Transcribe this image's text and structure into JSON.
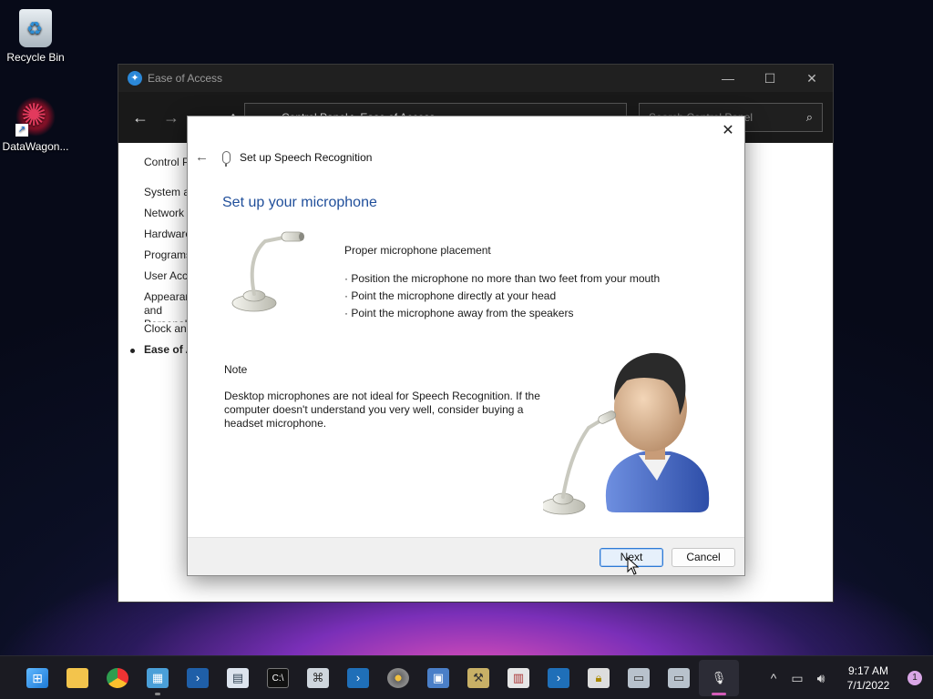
{
  "desktop": {
    "icons": [
      {
        "label": "Recycle Bin"
      },
      {
        "label": "DataWagon..."
      }
    ]
  },
  "control_panel": {
    "title": "Ease of Access",
    "address": "Control Panel  >  Ease of Access",
    "search_placeholder": "Search Control Panel",
    "sidebar": [
      "Control Panel Home",
      "System and Security",
      "Network and Internet",
      "Hardware and Sound",
      "Programs",
      "User Accounts",
      "Appearance and Personalization",
      "Clock and Region",
      "Ease of Access"
    ]
  },
  "dialog": {
    "wizard_title": "Set up Speech Recognition",
    "heading": "Set up your microphone",
    "placement_title": "Proper microphone placement",
    "placement_items": [
      "· Position the microphone no more than two feet from your mouth",
      "· Point the microphone directly at your head",
      "· Point the microphone away from the speakers"
    ],
    "note_title": "Note",
    "note_text": "Desktop microphones are not ideal for Speech Recognition. If the computer doesn't understand you very well, consider buying a headset microphone.",
    "next_label": "Next",
    "cancel_label": "Cancel"
  },
  "taskbar": {
    "time": "9:17 AM",
    "date": "7/1/2022",
    "notification_count": "1"
  },
  "colors": {
    "heading_blue": "#1f4e9a",
    "taskbar_bg": "#1b1b22",
    "default_button_border": "#2d7ad6"
  }
}
